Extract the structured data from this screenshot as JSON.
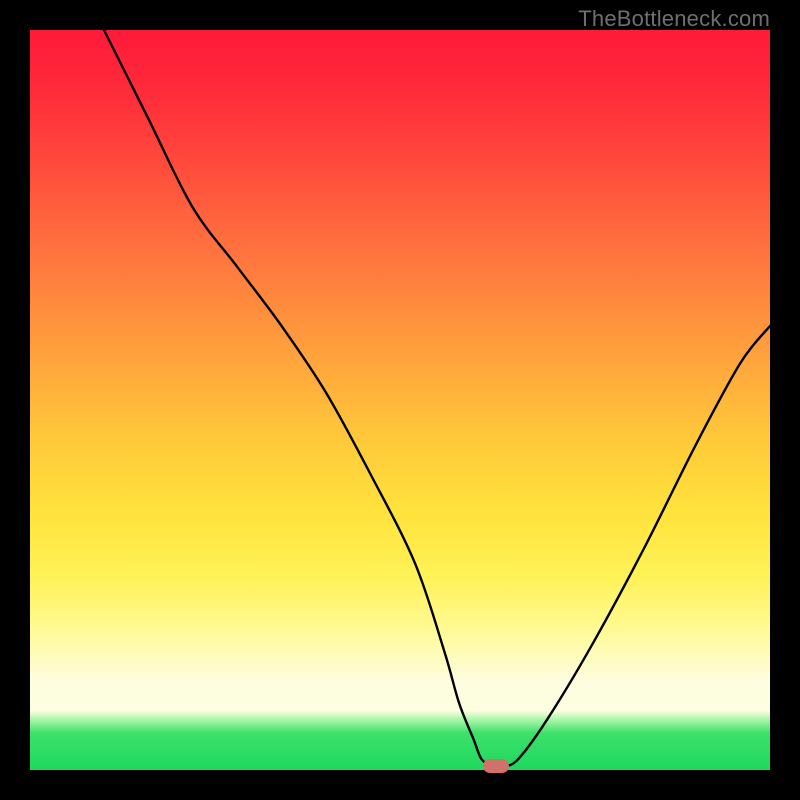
{
  "watermark": "TheBottleneck.com",
  "colors": {
    "frame": "#000000",
    "gradient_top": "#ff1a3a",
    "gradient_mid": "#ffe23c",
    "gradient_bottom": "#1fd85f",
    "curve": "#000000",
    "marker": "#d2706a"
  },
  "chart_data": {
    "type": "line",
    "title": "",
    "xlabel": "",
    "ylabel": "",
    "xlim": [
      0,
      100
    ],
    "ylim": [
      0,
      100
    ],
    "axes_visible": false,
    "grid": false,
    "series": [
      {
        "name": "bottleneck-curve",
        "x": [
          10,
          16,
          22,
          28,
          34,
          40,
          46,
          52,
          56,
          58,
          60,
          61,
          62.5,
          64,
          66,
          70,
          76,
          83,
          90,
          96,
          100
        ],
        "values": [
          100,
          88,
          76,
          68,
          60,
          51,
          40,
          28,
          16,
          9,
          4,
          1.5,
          0.5,
          0.5,
          1.5,
          7,
          17,
          30,
          44,
          55,
          60
        ]
      }
    ],
    "marker": {
      "x": 63,
      "y": 0.5,
      "shape": "pill"
    },
    "notes": "Values are read off the image; y is percent-of-height from the bottom band (0 = at green baseline, 100 = at top). The curve descends steeply from upper-left, with a slight convex kink around x≈28, reaches a flat minimum near x≈63, then rises again toward the right edge."
  }
}
